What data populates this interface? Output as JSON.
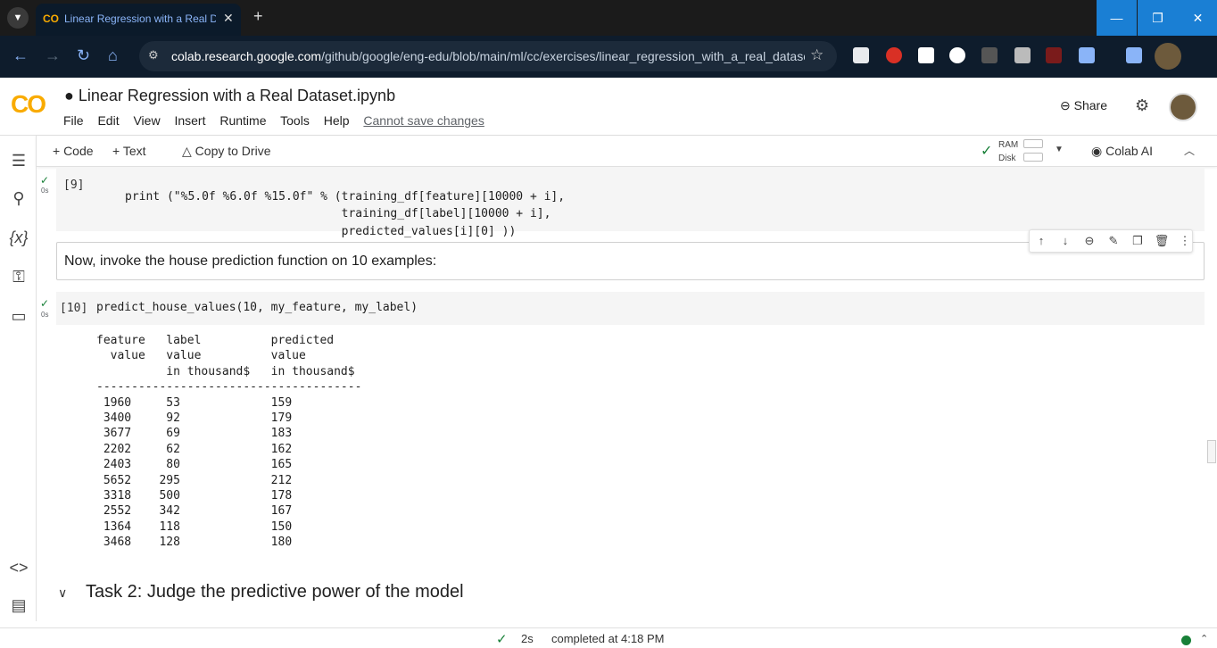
{
  "browser": {
    "tab_title": "Linear Regression with a Real Dataset.ipynb",
    "url_host": "colab.research.google.com",
    "url_path": "/github/google/eng-edu/blob/main/ml/cc/exercises/linear_regression_with_a_real_datase...",
    "icons": [
      "tab-search-icon",
      "colab-icon",
      "close-icon",
      "plus-icon",
      "back-icon",
      "forward-icon",
      "reload-icon",
      "home-icon",
      "star-icon"
    ]
  },
  "colab": {
    "notebook_title": "Linear Regression with a Real Dataset.ipynb",
    "menu": [
      "File",
      "Edit",
      "View",
      "Insert",
      "Runtime",
      "Tools",
      "Help"
    ],
    "cannot_save": "Cannot save changes",
    "share_label": "Share"
  },
  "toolbar": {
    "code_label": "+ Code",
    "text_label": "+ Text",
    "copy_drive_label": "Copy to Drive",
    "ram_label": "RAM",
    "disk_label": "Disk",
    "colab_ai_label": "Colab AI"
  },
  "cell9": {
    "count": "[9]",
    "time": "0s",
    "lines": [
      "print (\"%5.0f %6.0f %15.0f\" % (training_df[feature][10000 + i],",
      "                               training_df[label][10000 + i],",
      "                               predicted_values[i][0] ))"
    ]
  },
  "text_cell": {
    "content": "Now, invoke the house prediction function on 10 examples:"
  },
  "cell10": {
    "count": "[10]",
    "time": "0s",
    "code": "predict_house_values(10, my_feature, my_label)"
  },
  "output": {
    "header_lines": [
      "feature   label          predicted",
      "  value   value          value",
      "          in thousand$   in thousand$",
      "--------------------------------------"
    ],
    "rows": [
      [
        1960,
        53,
        159
      ],
      [
        3400,
        92,
        179
      ],
      [
        3677,
        69,
        183
      ],
      [
        2202,
        62,
        162
      ],
      [
        2403,
        80,
        165
      ],
      [
        5652,
        295,
        212
      ],
      [
        3318,
        500,
        178
      ],
      [
        2552,
        342,
        167
      ],
      [
        1364,
        118,
        150
      ],
      [
        3468,
        128,
        180
      ]
    ]
  },
  "task_heading": "Task 2: Judge the predictive power of the model",
  "status": {
    "time": "2s",
    "text": "completed at 4:18 PM"
  },
  "colors": {
    "accent": "#188038",
    "colab_orange": "#f9ab00",
    "chrome_blue": "#1a7fd4"
  }
}
